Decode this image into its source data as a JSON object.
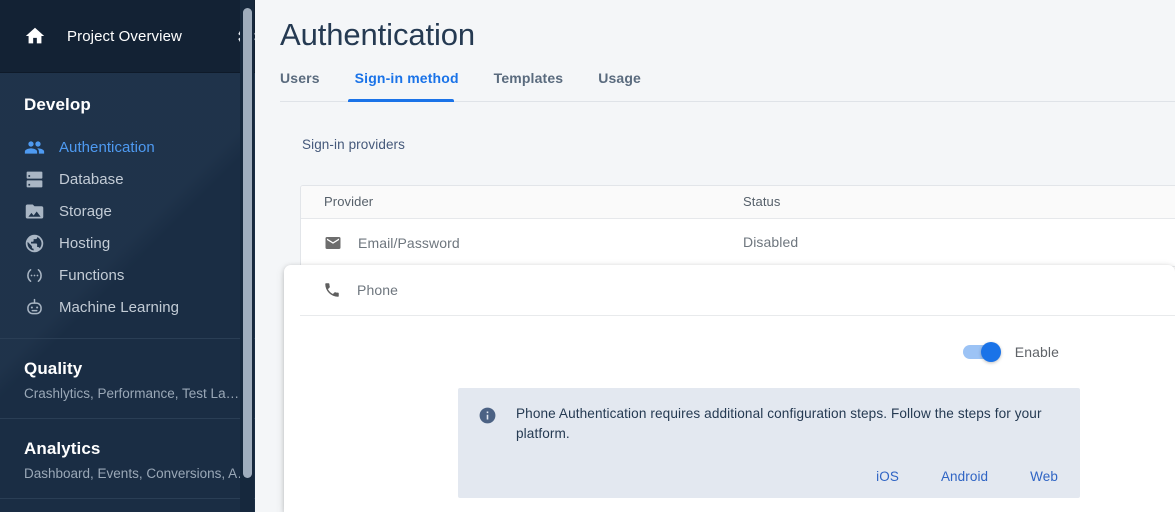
{
  "sidebar": {
    "project_overview": "Project Overview",
    "home_icon": "home-icon",
    "settings_icon": "gear-icon",
    "develop_title": "Develop",
    "nav_items": [
      {
        "label": "Authentication",
        "icon": "people-icon",
        "active": true
      },
      {
        "label": "Database",
        "icon": "database-icon",
        "active": false
      },
      {
        "label": "Storage",
        "icon": "image-folder-icon",
        "active": false
      },
      {
        "label": "Hosting",
        "icon": "globe-icon",
        "active": false
      },
      {
        "label": "Functions",
        "icon": "functions-icon",
        "active": false
      },
      {
        "label": "Machine Learning",
        "icon": "robot-icon",
        "active": false
      }
    ],
    "blocks": [
      {
        "title": "Quality",
        "subtitle": "Crashlytics, Performance, Test La…"
      },
      {
        "title": "Analytics",
        "subtitle": "Dashboard, Events, Conversions, A…"
      }
    ]
  },
  "main": {
    "page_title": "Authentication",
    "tabs": [
      {
        "label": "Users",
        "active": false
      },
      {
        "label": "Sign-in method",
        "active": true
      },
      {
        "label": "Templates",
        "active": false
      },
      {
        "label": "Usage",
        "active": false
      }
    ],
    "providers_label": "Sign-in providers",
    "table": {
      "headers": [
        "Provider",
        "Status"
      ],
      "rows": [
        {
          "provider": "Email/Password",
          "status": "Disabled",
          "icon": "envelope-icon"
        }
      ]
    },
    "phone_panel": {
      "provider": "Phone",
      "icon": "phone-icon",
      "toggle_label": "Enable",
      "toggle_on": true,
      "notice": {
        "icon": "info-icon",
        "text": "Phone Authentication requires additional configuration steps. Follow the steps for your platform.",
        "links": [
          "iOS",
          "Android",
          "Web"
        ]
      }
    }
  },
  "colors": {
    "sidebar_bg": "#1b2f47",
    "sidebar_top_bg": "#132234",
    "accent_blue": "#1a73e8",
    "active_nav_blue": "#4e9af1",
    "page_bg": "#f4f6f8",
    "notice_bg": "#e3e8f0",
    "title_color": "#253a52"
  }
}
